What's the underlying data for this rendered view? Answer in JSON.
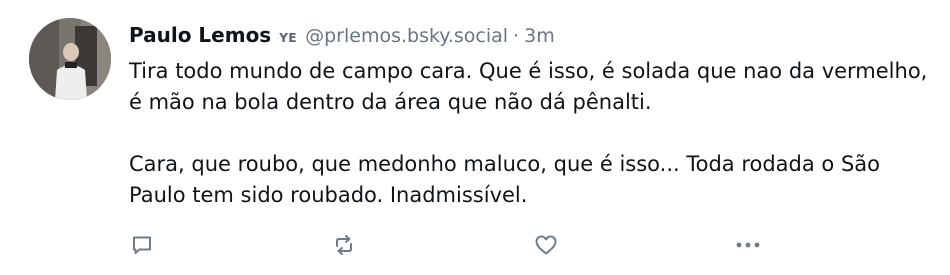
{
  "post": {
    "author": {
      "display_name": "Paulo Lemos",
      "badge": "YE",
      "handle": "@prlemos.bsky.social"
    },
    "separator": "·",
    "time": "3m",
    "paragraphs": [
      "Tira todo mundo de campo cara. Que é isso, é solada que nao da vermelho, é mão na bola dentro da área que não dá pênalti.",
      "Cara, que roubo, que medonho maluco, que é isso... Toda rodada o São Paulo tem sido roubado. Inadmissível."
    ],
    "actions": [
      {
        "name": "reply",
        "icon": "speech-bubble-icon"
      },
      {
        "name": "repost",
        "icon": "repost-arrows-icon"
      },
      {
        "name": "like",
        "icon": "heart-icon"
      },
      {
        "name": "more",
        "icon": "ellipsis-icon"
      }
    ],
    "colors": {
      "text": "#0f1419",
      "secondary": "#687684",
      "icon": "#6f7d8a"
    }
  }
}
